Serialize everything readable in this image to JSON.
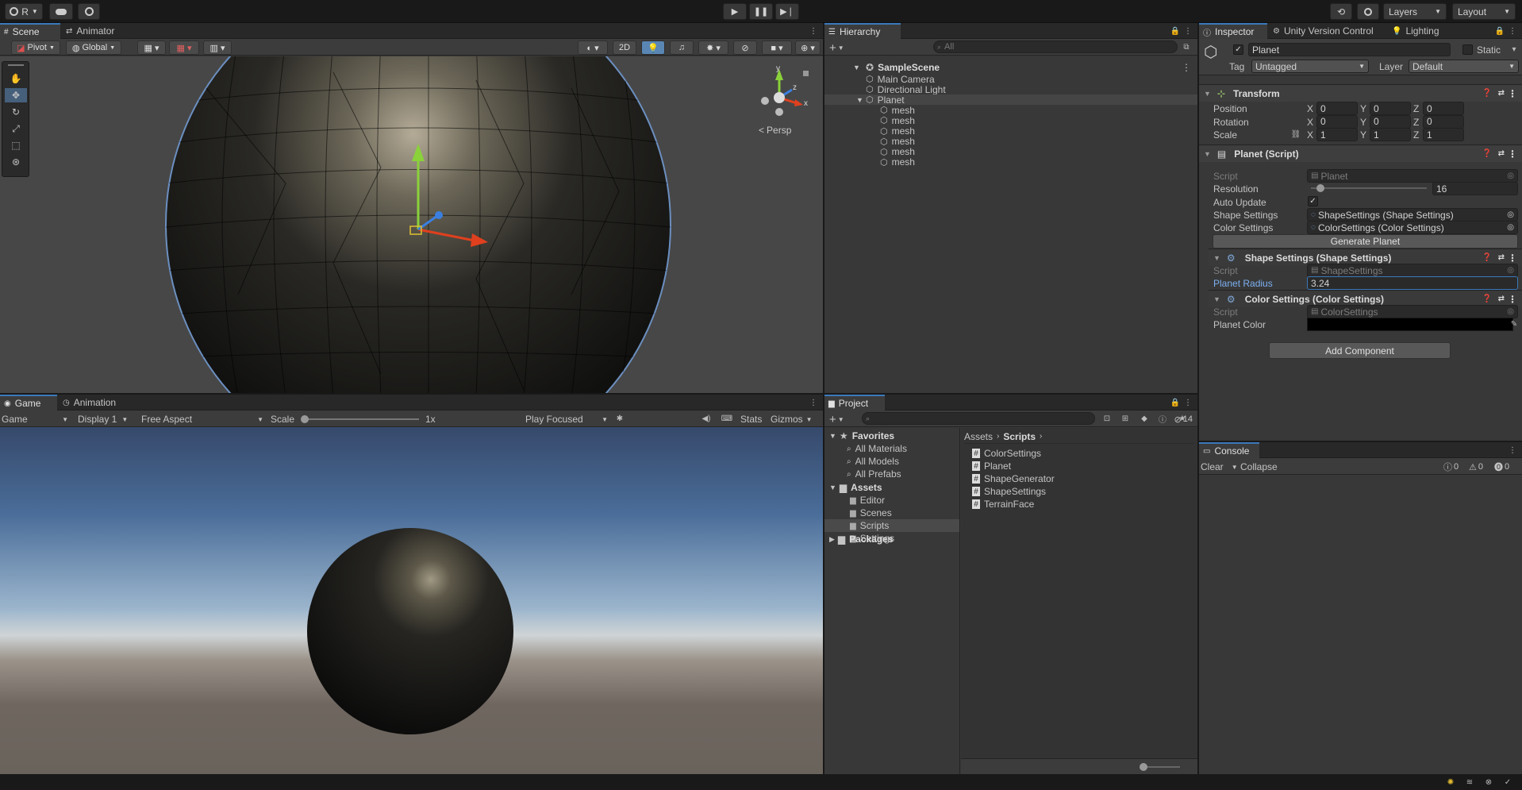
{
  "topbar": {
    "account_label": "R",
    "play_icon": "play-icon",
    "layers_label": "Layers",
    "layout_label": "Layout"
  },
  "scene": {
    "tab_scene": "Scene",
    "tab_animator": "Animator",
    "pivot_label": "Pivot",
    "global_label": "Global",
    "mode_2d": "2D",
    "persp_label": "Persp",
    "gizmo_x": "x",
    "gizmo_y": "y",
    "gizmo_z": "z"
  },
  "game": {
    "tab_game": "Game",
    "tab_animation": "Animation",
    "view_select": "Game",
    "display_select": "Display 1",
    "aspect_select": "Free Aspect",
    "scale_label": "Scale",
    "scale_value": "1x",
    "play_mode_select": "Play Focused",
    "stats_label": "Stats",
    "gizmos_label": "Gizmos"
  },
  "hierarchy": {
    "tab_label": "Hierarchy",
    "search_placeholder": "All",
    "scene_name": "SampleScene",
    "items": [
      {
        "label": "Main Camera",
        "indent": 1
      },
      {
        "label": "Directional Light",
        "indent": 1
      },
      {
        "label": "Planet",
        "indent": 1
      },
      {
        "label": "mesh",
        "indent": 2
      },
      {
        "label": "mesh",
        "indent": 2
      },
      {
        "label": "mesh",
        "indent": 2
      },
      {
        "label": "mesh",
        "indent": 2
      },
      {
        "label": "mesh",
        "indent": 2
      },
      {
        "label": "mesh",
        "indent": 2
      }
    ]
  },
  "project": {
    "tab_label": "Project",
    "hidden_count": "14",
    "favorites_label": "Favorites",
    "favorites": [
      "All Materials",
      "All Models",
      "All Prefabs"
    ],
    "assets_label": "Assets",
    "asset_folders": [
      "Editor",
      "Scenes",
      "Scripts",
      "Settings"
    ],
    "packages_label": "Packages",
    "breadcrumb_root": "Assets",
    "breadcrumb_current": "Scripts",
    "files": [
      "ColorSettings",
      "Planet",
      "ShapeGenerator",
      "ShapeSettings",
      "TerrainFace"
    ]
  },
  "inspector": {
    "tab_inspector": "Inspector",
    "tab_uvc": "Unity Version Control",
    "tab_lighting": "Lighting",
    "object_name": "Planet",
    "static_label": "Static",
    "tag_label": "Tag",
    "tag_value": "Untagged",
    "layer_label": "Layer",
    "layer_value": "Default",
    "transform": {
      "title": "Transform",
      "position_label": "Position",
      "rotation_label": "Rotation",
      "scale_label": "Scale",
      "position": [
        "0",
        "0",
        "0"
      ],
      "rotation": [
        "0",
        "0",
        "0"
      ],
      "scale": [
        "1",
        "1",
        "1"
      ],
      "axis_x": "X",
      "axis_y": "Y",
      "axis_z": "Z"
    },
    "planet_script": {
      "title": "Planet (Script)",
      "script_label": "Script",
      "script_value": "Planet",
      "resolution_label": "Resolution",
      "resolution_value": "16",
      "resolution_fraction": 0.08,
      "auto_update_label": "Auto Update",
      "shape_settings_label": "Shape Settings",
      "shape_settings_value": "ShapeSettings (Shape Settings)",
      "color_settings_label": "Color Settings",
      "color_settings_value": "ColorSettings (Color Settings)",
      "generate_button": "Generate Planet"
    },
    "shape_settings": {
      "title": "Shape Settings (Shape Settings)",
      "script_label": "Script",
      "script_value": "ShapeSettings",
      "radius_label": "Planet Radius",
      "radius_value": "3.24"
    },
    "color_settings": {
      "title": "Color Settings (Color Settings)",
      "script_label": "Script",
      "script_value": "ColorSettings",
      "color_label": "Planet Color",
      "color_value": "#000000"
    },
    "add_component": "Add Component"
  },
  "console": {
    "tab_label": "Console",
    "clear_label": "Clear",
    "collapse_label": "Collapse",
    "log_count": "0",
    "warn_count": "0",
    "error_count": "0"
  },
  "colors": {
    "accent": "#3a79bb",
    "panel": "#383838",
    "field": "#2a2a2a",
    "sky_top": "#36496b",
    "horizon": "#c0c4c8",
    "ground": "#6a635c"
  }
}
